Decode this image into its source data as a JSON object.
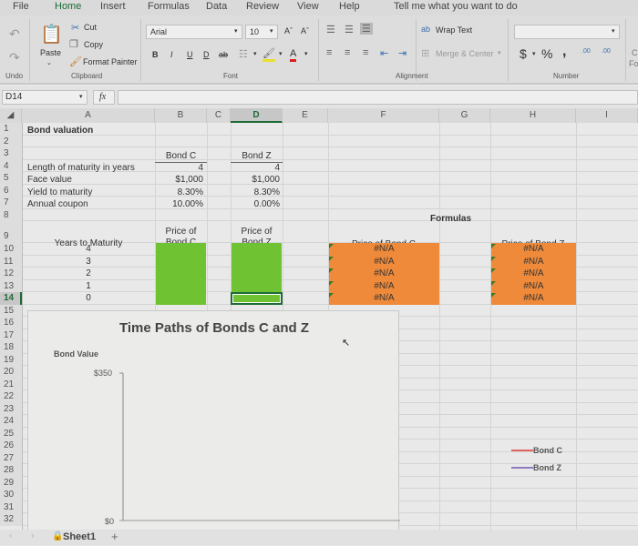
{
  "menu": [
    "File",
    "Home",
    "Insert",
    "Formulas",
    "Data",
    "Review",
    "View",
    "Help",
    "Tell me what you want to do"
  ],
  "ribbon": {
    "undo_label": "Undo",
    "clipboard": {
      "paste": "Paste",
      "cut": "Cut",
      "copy": "Copy",
      "format_painter": "Format Painter",
      "label": "Clipboard"
    },
    "font": {
      "name": "Arial",
      "size": "10",
      "label": "Font",
      "bold": "B",
      "italic": "I",
      "underline": "U",
      "double_underline": "D",
      "strike": "ab",
      "grow": "Aˆ",
      "shrink": "Aˇ",
      "font_color": "A"
    },
    "alignment": {
      "wrap_text": "Wrap Text",
      "merge_center": "Merge & Center",
      "label": "Alignment"
    },
    "number": {
      "format": "",
      "currency": "$",
      "percent": "%",
      "comma": ",",
      "inc_decimal": ".00",
      "dec_decimal": ".00",
      "label": "Number"
    },
    "cut_off_right": [
      "C",
      "Fo"
    ]
  },
  "formula_bar": {
    "name_box": "D14",
    "fx": "fx",
    "formula": ""
  },
  "columns": [
    "A",
    "B",
    "C",
    "D",
    "E",
    "F",
    "G",
    "H",
    "I"
  ],
  "active_column": "D",
  "active_row": "14",
  "rows": [
    "1",
    "2",
    "3",
    "4",
    "5",
    "6",
    "7",
    "8",
    "9",
    "10",
    "11",
    "12",
    "13",
    "14",
    "15",
    "16",
    "17",
    "18",
    "19",
    "20",
    "21",
    "22",
    "23",
    "24",
    "25",
    "26",
    "27",
    "28",
    "29",
    "30",
    "31",
    "32"
  ],
  "sheet": {
    "title": "Bond valuation",
    "bond_c_header": "Bond C",
    "bond_z_header": "Bond Z",
    "labels": [
      "Length of maturity in years",
      "Face value",
      "Yield to maturity",
      "Annual coupon"
    ],
    "bond_c_values": [
      "4",
      "$1,000",
      "8.30%",
      "10.00%"
    ],
    "bond_z_values": [
      "4",
      "$1,000",
      "8.30%",
      "0.00%"
    ],
    "formulas_label": "Formulas",
    "years_header": "Years to Maturity",
    "years": [
      "4",
      "3",
      "2",
      "1",
      "0"
    ],
    "price_c_header_l1": "Price of",
    "price_c_header_l2": "Bond C",
    "price_z_header_l1": "Price of",
    "price_z_header_l2": "Bond Z",
    "formula_c_header": "Price of Bond C",
    "formula_z_header": "Price of Bond Z",
    "formula_c_values": [
      "#N/A",
      "#N/A",
      "#N/A",
      "#N/A",
      "#N/A"
    ],
    "formula_z_values": [
      "#N/A",
      "#N/A",
      "#N/A",
      "#N/A",
      "#N/A"
    ]
  },
  "chart": {
    "title": "Time Paths of Bonds C and Z",
    "ylabel": "Bond Value",
    "y_top_tick": "$350",
    "y_bottom_tick": "$0",
    "legend": [
      {
        "name": "Bond C",
        "color": "#e06666"
      },
      {
        "name": "Bond Z",
        "color": "#8e7cc3"
      }
    ]
  },
  "chart_data": {
    "type": "line",
    "title": "Time Paths of Bonds C and Z",
    "ylabel": "Bond Value",
    "xlabel": "",
    "ylim": [
      0,
      350
    ],
    "y_ticks": [
      "$0",
      "$350"
    ],
    "legend_position": "right",
    "series": [
      {
        "name": "Bond C",
        "values": []
      },
      {
        "name": "Bond Z",
        "values": []
      }
    ]
  },
  "colors": {
    "green_fill": "#6fc231",
    "orange_fill": "#ee8a3a"
  },
  "sheet_tabs": {
    "active": "Sheet1",
    "add": "+"
  }
}
